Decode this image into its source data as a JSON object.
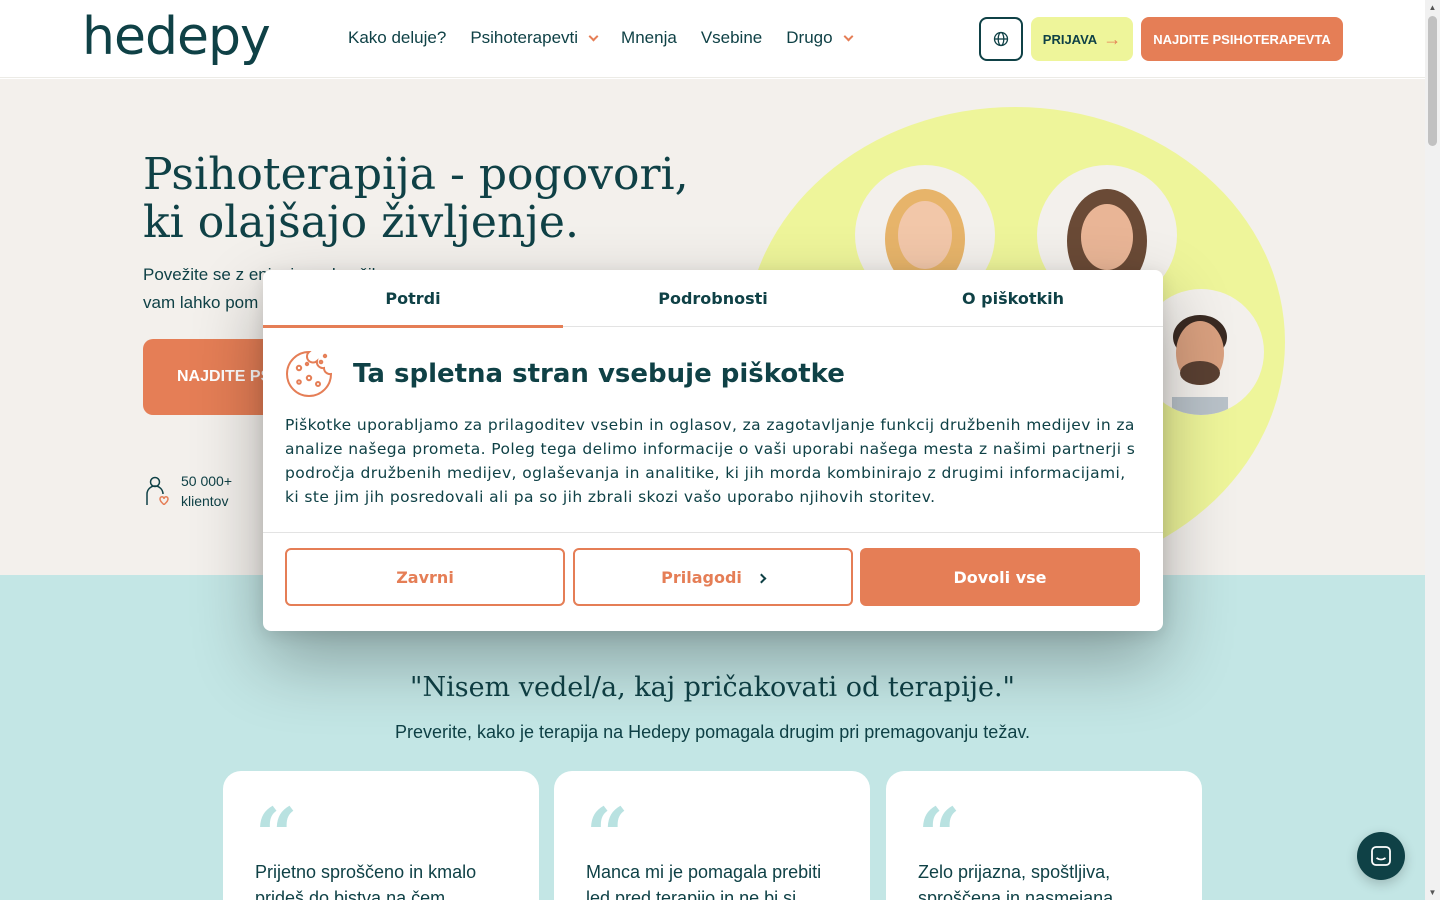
{
  "header": {
    "logo": "hedepy",
    "nav": [
      {
        "label": "Kako deluje?",
        "dropdown": false
      },
      {
        "label": "Psihoterapevti",
        "dropdown": true
      },
      {
        "label": "Mnenja",
        "dropdown": false
      },
      {
        "label": "Vsebine",
        "dropdown": false
      },
      {
        "label": "Drugo",
        "dropdown": true
      }
    ],
    "language_icon": "globe-icon",
    "login_label": "PRIJAVA",
    "find_label": "NAJDITE PSIHOTERAPEVTA"
  },
  "hero": {
    "title_line1": "Psihoterapija - pogovori,",
    "title_line2": "ki olajšajo življenje.",
    "subtitle_line1": "Povežite se z enim izmed naših",
    "subtitle_line2": "vam lahko pom",
    "cta_label": "NAJDITE PS",
    "stat_value": "50 000+",
    "stat_label": "klientov"
  },
  "cookie": {
    "tabs": [
      "Potrdi",
      "Podrobnosti",
      "O piškotkih"
    ],
    "active_tab": "Potrdi",
    "title": "Ta spletna stran vsebuje piškotke",
    "body": "Piškotke uporabljamo za prilagoditev vsebin in oglasov, za zagotavljanje funkcij družbenih medijev in za analize našega prometa. Poleg tega delimo informacije o vaši uporabi našega mesta z našimi partnerji s področja družbenih medijev, oglaševanja in analitike, ki jih morda kombinirajo z drugimi informacijami, ki ste jim jih posredovali ali pa so jih zbrali skozi vašo uporabo njihovih storitev.",
    "btn_close": "Zavrni",
    "btn_customize": "Prilagodi",
    "btn_allow": "Dovoli vse"
  },
  "testimonials": {
    "title": "\"Nisem vedel/a, kaj pričakovati od terapije.\"",
    "subtitle": "Preverite, kako je terapija na Hedepy pomagala drugim pri premagovanju težav.",
    "cards": [
      {
        "text": "Prijetno sproščeno in kmalo prideš do bistva na čem"
      },
      {
        "text": "Manca mi je pomagala prebiti led pred terapijo in ne bi si"
      },
      {
        "text": "Zelo prijazna, spoštljiva, sproščena in nasmejana"
      }
    ]
  },
  "colors": {
    "brand_dark": "#0f4146",
    "accent": "#e57e56",
    "lime": "#eef59a",
    "mint": "#c3e6e5",
    "cream": "#f3f0ec"
  }
}
